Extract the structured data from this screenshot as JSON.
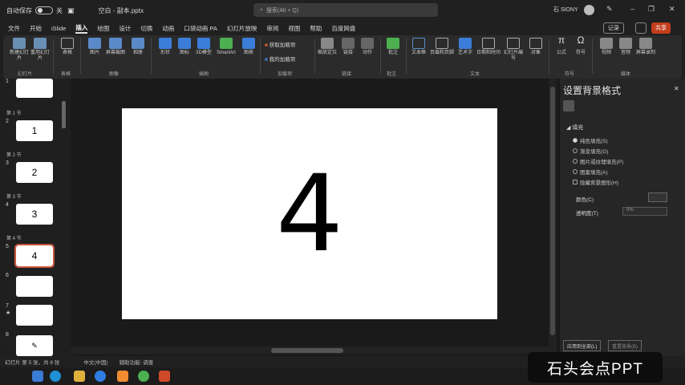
{
  "titlebar": {
    "autosave_label": "自动保存",
    "autosave_state": "关",
    "doc_title": "空白 - 副本.pptx",
    "search_placeholder": "搜索(Alt + Q)",
    "user_name": "石 SIONY"
  },
  "menu": {
    "tabs": [
      "文件",
      "开始",
      "iSlide",
      "插入",
      "绘图",
      "设计",
      "切换",
      "动画",
      "口袋动画 PA",
      "幻灯片放映",
      "审阅",
      "视图",
      "帮助",
      "百度网盘"
    ],
    "active_tab": "插入",
    "record_label": "记录",
    "share_label": "共享"
  },
  "ribbon": {
    "items": [
      "新建幻灯片",
      "重用幻灯片",
      "表格",
      "图片",
      "屏幕截图",
      "相册",
      "形状",
      "图标",
      "3D模型",
      "SmartArt",
      "图表",
      "获取加载项",
      "我的加载项",
      "缩放定位",
      "链接",
      "动作",
      "批注",
      "文本框",
      "页眉和页脚",
      "艺术字",
      "日期和时间",
      "幻灯片编号",
      "对象",
      "公式",
      "符号",
      "视频",
      "音频",
      "屏幕录制"
    ],
    "groups": [
      "幻灯片",
      "表格",
      "图像",
      "插图",
      "加载项",
      "链接",
      "批注",
      "文本",
      "符号",
      "媒体"
    ]
  },
  "thumbnails": {
    "sections": [
      "第 1 节",
      "第 2 节",
      "第 3 节",
      "第 4 节"
    ],
    "slides": [
      {
        "num": "1",
        "text": ""
      },
      {
        "num": "2",
        "text": "1"
      },
      {
        "num": "3",
        "text": "2"
      },
      {
        "num": "4",
        "text": "3"
      },
      {
        "num": "5",
        "text": "4"
      },
      {
        "num": "6",
        "text": ""
      },
      {
        "num": "7",
        "text": ""
      },
      {
        "num": "8",
        "text": "✎"
      }
    ],
    "selected_index": 4
  },
  "slide": {
    "number_text": "4"
  },
  "pane": {
    "title": "设置背景格式",
    "section": "填充",
    "options": [
      "纯色填充(S)",
      "渐变填充(G)",
      "图片或纹理填充(P)",
      "图案填充(A)",
      "隐藏背景图形(H)"
    ],
    "selected_option": 0,
    "color_label": "颜色(C)",
    "transparency_label": "透明度(T)",
    "transparency_value": "0%",
    "apply_all": "应用到全部(L)",
    "reset": "重置背景(B)"
  },
  "status": {
    "slide_info": "幻灯片 第 5 张，共 8 张",
    "language": "中文(中国)",
    "accessibility": "辅助功能: 调查"
  },
  "watermark": "石头会点PPT"
}
